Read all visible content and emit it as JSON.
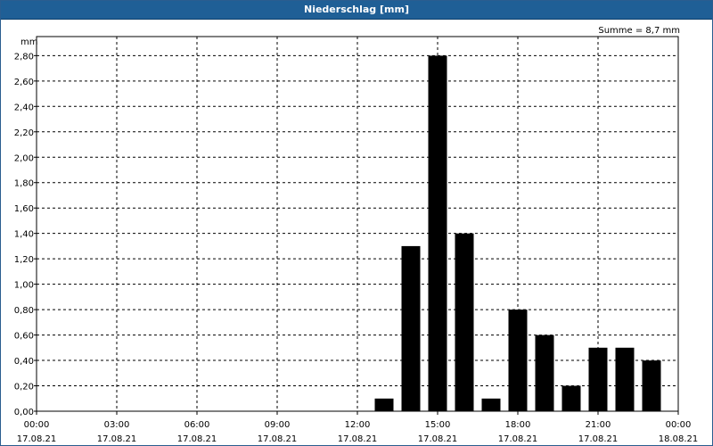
{
  "window": {
    "title": "Niederschlag [mm]"
  },
  "chart_data": {
    "type": "bar",
    "title": "Niederschlag [mm]",
    "ylabel": "mm",
    "sum_label": "Summe = 8,7 mm",
    "ylim": [
      0,
      2.95
    ],
    "y_ticks": [
      "0,00",
      "0,20",
      "0,40",
      "0,60",
      "0,80",
      "1,00",
      "1,20",
      "1,40",
      "1,60",
      "1,80",
      "2,00",
      "2,20",
      "2,40",
      "2,60",
      "2,80"
    ],
    "x_ticks": [
      {
        "time": "00:00",
        "date": "17.08.21"
      },
      {
        "time": "03:00",
        "date": "17.08.21"
      },
      {
        "time": "06:00",
        "date": "17.08.21"
      },
      {
        "time": "09:00",
        "date": "17.08.21"
      },
      {
        "time": "12:00",
        "date": "17.08.21"
      },
      {
        "time": "15:00",
        "date": "17.08.21"
      },
      {
        "time": "18:00",
        "date": "17.08.21"
      },
      {
        "time": "21:00",
        "date": "17.08.21"
      },
      {
        "time": "00:00",
        "date": "18.08.21"
      }
    ],
    "grid": true,
    "bar_color": "#000000",
    "hours": [
      13,
      14,
      15,
      16,
      17,
      18,
      19,
      20,
      21,
      22,
      23
    ],
    "values": [
      0.1,
      1.3,
      2.8,
      1.4,
      0.1,
      0.8,
      0.6,
      0.2,
      0.5,
      0.5,
      0.4
    ]
  }
}
